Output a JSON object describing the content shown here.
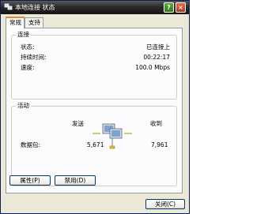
{
  "window": {
    "title": "本地连接 状态"
  },
  "tabs": [
    {
      "label": "常规",
      "active": true
    },
    {
      "label": "支持",
      "active": false
    }
  ],
  "connection": {
    "group_title": "连接",
    "rows": [
      {
        "label": "状态:",
        "value": "已连接上"
      },
      {
        "label": "持续时间:",
        "value": "00:22:17"
      },
      {
        "label": "速度:",
        "value": "100.0 Mbps"
      }
    ]
  },
  "activity": {
    "group_title": "活动",
    "sent_label": "发送",
    "received_label": "收到",
    "packets_label": "数据包:",
    "packets_sent": "5,671",
    "packets_received": "7,961"
  },
  "buttons": {
    "properties": "属性(P)",
    "disable": "禁用(D)",
    "close": "关闭(C)"
  },
  "titlebar": {
    "help": "?",
    "close": "×"
  },
  "colors": {
    "title_bar": "#2a2a2a",
    "tab_accent": "#e68b2c",
    "face": "#ece9d8"
  }
}
